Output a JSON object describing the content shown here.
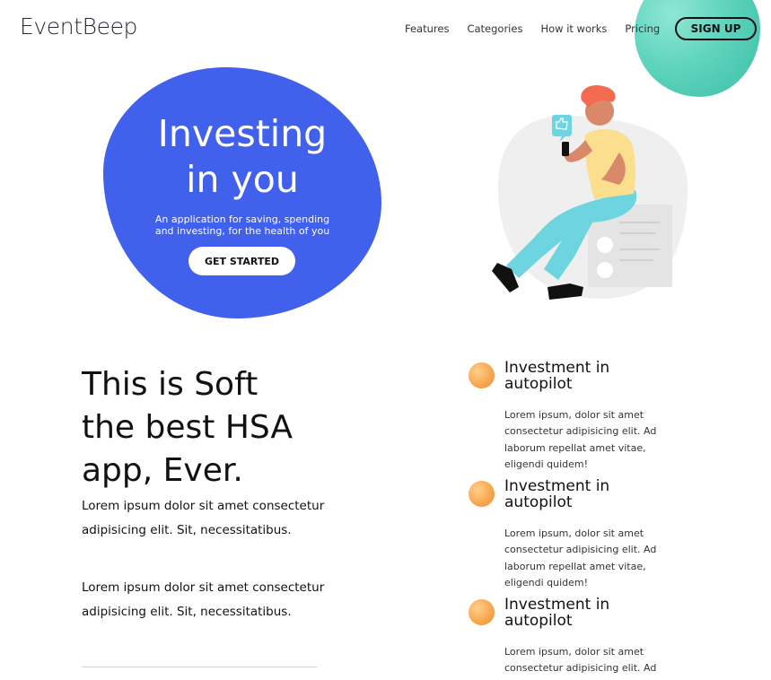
{
  "brand": {
    "logo_text": "EventBeep"
  },
  "nav": {
    "items": [
      "Features",
      "Categories",
      "How it works",
      "Pricing"
    ],
    "signup_label": "SIGN UP"
  },
  "hero": {
    "title_line1": "Investing",
    "title_line2": "in you",
    "subtitle_line1": "An application for saving, spending",
    "subtitle_line2": "and investing, for the health of you",
    "cta_label": "GET STARTED"
  },
  "main": {
    "heading_line1": "This is Soft",
    "heading_line2": "the best HSA",
    "heading_line3": "app, Ever.",
    "paragraph_1": "Lorem ipsum dolor sit amet consectetur adipisicing elit. Sit, necessitatibus.",
    "paragraph_2": "Lorem ipsum dolor sit amet consectetur adipisicing elit. Sit, necessitatibus."
  },
  "features": [
    {
      "title": "Investment in autopilot",
      "text": "Lorem ipsum, dolor sit amet consectetur adipisicing elit. Ad laborum repellat amet vitae, eligendi quidem!"
    },
    {
      "title": "Investment in autopilot",
      "text": "Lorem ipsum, dolor sit amet consectetur adipisicing elit. Ad laborum repellat amet vitae, eligendi quidem!"
    },
    {
      "title": "Investment in autopilot",
      "text": "Lorem ipsum, dolor sit amet consectetur adipisicing elit. Ad laborum repellat amet vitae, eligendi quidem!"
    }
  ],
  "colors": {
    "hero_blue": "#4160ec",
    "accent_teal": "#4fcab3",
    "feature_orange": "#f8a850"
  },
  "icons": {
    "feature_bullet": "orange-circle-icon",
    "phone_notification": "thumbs-up-icon"
  }
}
